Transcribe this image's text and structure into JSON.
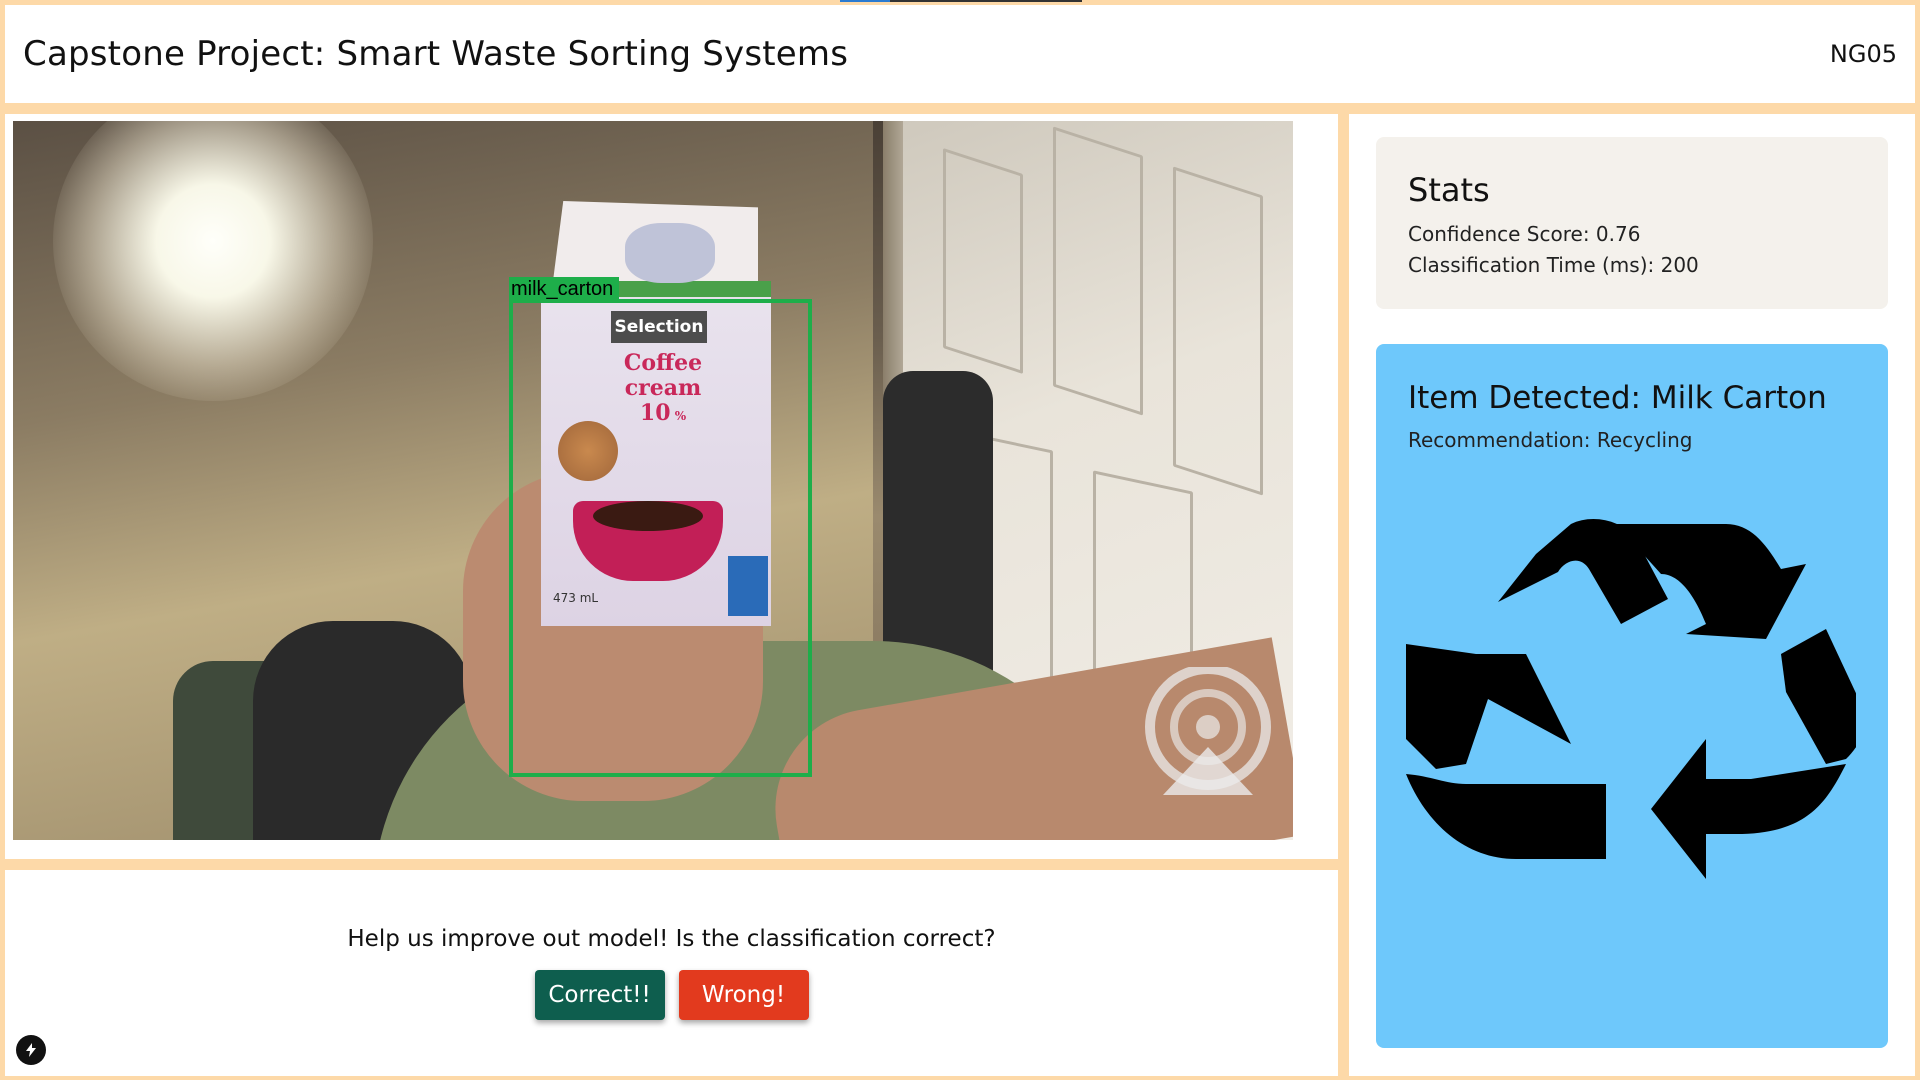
{
  "header": {
    "title": "Capstone Project: Smart Waste Sorting Systems",
    "tag": "NG05"
  },
  "camera": {
    "detection_label": "milk_carton",
    "carton_brand": "Selection",
    "carton_product": "Coffee cream",
    "carton_percent": "10",
    "carton_volume": "473 mL"
  },
  "feedback": {
    "question": "Help us improve out model! Is the classification correct?",
    "correct_label": "Correct!!",
    "wrong_label": "Wrong!"
  },
  "stats": {
    "title": "Stats",
    "confidence": "Confidence Score: 0.76",
    "classification_time": "Classification Time (ms): 200"
  },
  "detection": {
    "title": "Item Detected: Milk Carton",
    "recommendation": "Recommendation: Recycling",
    "icon": "recycle-icon"
  },
  "colors": {
    "page_bg": "#fdd9a8",
    "detect_box": "#1eae4a",
    "correct_btn": "#0e5e4e",
    "wrong_btn": "#e23a1e",
    "detect_card": "#6ec8fb",
    "stats_card": "#f4f1ec"
  }
}
